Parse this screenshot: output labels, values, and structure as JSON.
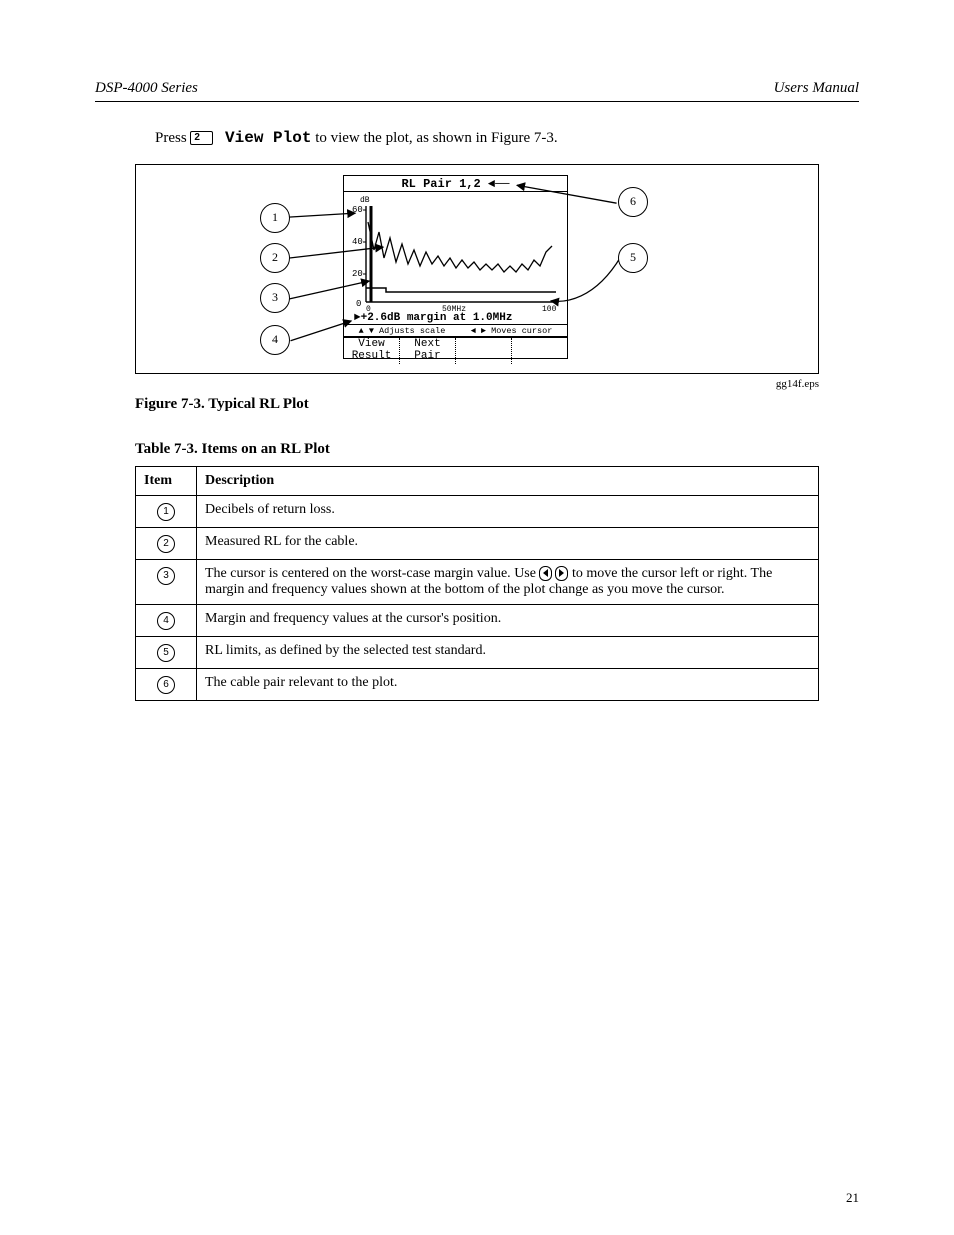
{
  "header": {
    "left": "DSP-4000 Series",
    "right": "Users Manual"
  },
  "intro_pre": "Press ",
  "intro_key": "2",
  "intro_mono": " View Plot",
  "intro_post": " to view the plot, as shown in Figure 7-3.",
  "screen": {
    "title": "RL Pair 1,2 ◄──",
    "axis": {
      "yunit": "dB",
      "yticks": [
        "60",
        "40",
        "20",
        "0"
      ],
      "xcenter": "50MHz",
      "xend": "100",
      "x0": "0"
    },
    "margin_arrow": "►",
    "margin_text": "+2.6dB margin at 1.0MHz",
    "hints": {
      "left": "▲ ▼ Adjusts scale",
      "right": "◄ ► Moves cursor"
    },
    "softkeys": [
      "View\nResult",
      "Next\nPair",
      "",
      ""
    ]
  },
  "callouts": [
    "1",
    "2",
    "3",
    "4",
    "5",
    "6"
  ],
  "figcode": "gg14f.eps",
  "figcaption": "Figure 7-3. Typical RL Plot",
  "tabletitle": "Table 7-3. Items on an RL Plot",
  "table": {
    "head": [
      "Item",
      "Description"
    ],
    "rows": [
      {
        "n": "1",
        "d": "Decibels of return loss."
      },
      {
        "n": "2",
        "d": "Measured RL for the cable."
      },
      {
        "n": "3",
        "d_pre": "The cursor is centered on the worst-case margin value. ",
        "d_mid": "Use ",
        "d_post": " to move the cursor left or right. The margin and frequency values shown at the bottom of the plot change as you move the cursor."
      },
      {
        "n": "4",
        "d": "Margin and frequency values at the cursor's position."
      },
      {
        "n": "5",
        "d": "RL limits, as defined by the selected test standard."
      },
      {
        "n": "6",
        "d": "The cable pair relevant to the plot."
      }
    ]
  },
  "pagenum": "21"
}
